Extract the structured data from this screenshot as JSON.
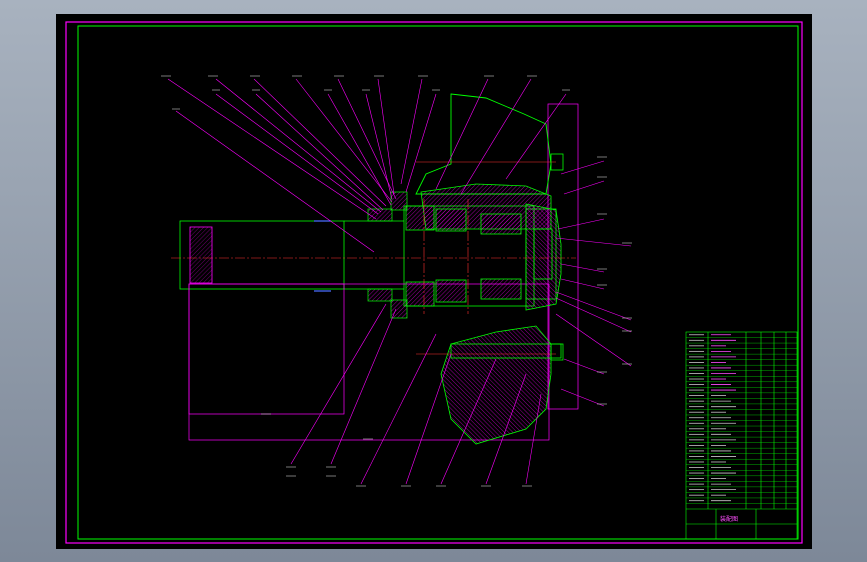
{
  "drawing": {
    "colors": {
      "background": "#000000",
      "frame": "#ff00ff",
      "inner_frame": "#00ff00",
      "outline": "#00ff00",
      "leader": "#ff00ff",
      "centerline": "#ff3030",
      "hatch": "#ff00ff",
      "accent": "#4a6cff",
      "text": "#d0d0d0"
    },
    "title_block": {
      "title": "装配图"
    }
  }
}
